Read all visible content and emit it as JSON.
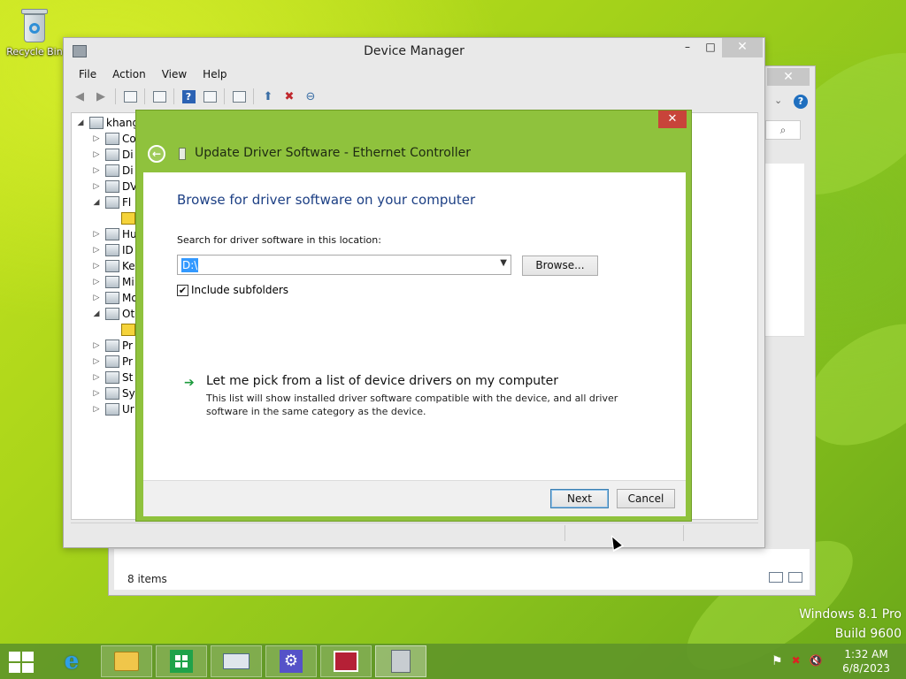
{
  "desktop": {
    "recycle_bin_label": "Recycle Bin",
    "watermark": {
      "line1": "Windows 8.1 Pro",
      "line2": "Build 9600"
    }
  },
  "background_window": {
    "close_glyph": "✕",
    "help_glyph": "?",
    "search_glyph": "⌕",
    "status_text": "8 items"
  },
  "device_manager": {
    "title": "Device Manager",
    "controls": {
      "minimize": "–",
      "maximize": "□",
      "close": "✕"
    },
    "menu": [
      "File",
      "Action",
      "View",
      "Help"
    ],
    "toolbar": [
      "back-icon",
      "forward-icon",
      "properties-icon",
      "console-tree-icon",
      "help-icon",
      "view-icon",
      "scan-hardware-icon",
      "update-driver-icon",
      "uninstall-icon",
      "disable-icon"
    ],
    "tree": [
      {
        "label": "khang",
        "expander": "◢",
        "level": 0
      },
      {
        "label": "Co",
        "expander": "▷",
        "level": 1
      },
      {
        "label": "Di",
        "expander": "▷",
        "level": 1
      },
      {
        "label": "Di",
        "expander": "▷",
        "level": 1
      },
      {
        "label": "DV",
        "expander": "▷",
        "level": 1
      },
      {
        "label": "Fl",
        "expander": "◢",
        "level": 1
      },
      {
        "label": "",
        "expander": "",
        "level": 2
      },
      {
        "label": "Hu",
        "expander": "▷",
        "level": 1
      },
      {
        "label": "ID",
        "expander": "▷",
        "level": 1
      },
      {
        "label": "Ke",
        "expander": "▷",
        "level": 1
      },
      {
        "label": "Mi",
        "expander": "▷",
        "level": 1
      },
      {
        "label": "Mo",
        "expander": "▷",
        "level": 1
      },
      {
        "label": "Ot",
        "expander": "◢",
        "level": 1
      },
      {
        "label": "",
        "expander": "",
        "level": 2
      },
      {
        "label": "Pr",
        "expander": "▷",
        "level": 1
      },
      {
        "label": "Pr",
        "expander": "▷",
        "level": 1
      },
      {
        "label": "St",
        "expander": "▷",
        "level": 1
      },
      {
        "label": "Sy",
        "expander": "▷",
        "level": 1
      },
      {
        "label": "Ur",
        "expander": "▷",
        "level": 1
      }
    ]
  },
  "wizard": {
    "close_glyph": "✕",
    "back_glyph": "←",
    "title": "Update Driver Software - Ethernet Controller",
    "heading": "Browse for driver software on your computer",
    "search_label": "Search for driver software in this location:",
    "path_value": "D:\\",
    "browse_button": "Browse...",
    "include_subfolders_label": "Include subfolders",
    "include_subfolders_checked": "✔",
    "pick_arrow": "➔",
    "pick_title": "Let me pick from a list of device drivers on my computer",
    "pick_description": "This list will show installed driver software compatible with the device, and all driver software in the same category as the device.",
    "next_button": "Next",
    "cancel_button": "Cancel"
  },
  "taskbar": {
    "pinned": [
      "internet-explorer",
      "file-explorer",
      "store",
      "on-screen-keyboard",
      "settings",
      "news",
      "device-manager"
    ],
    "tray_icons": [
      "flag-icon",
      "network-error-icon",
      "speaker-muted-icon"
    ],
    "tray_glyphs": {
      "flag": "⚑",
      "network": "✖",
      "speaker": "🔇"
    },
    "time": "1:32 AM",
    "date": "6/8/2023"
  }
}
